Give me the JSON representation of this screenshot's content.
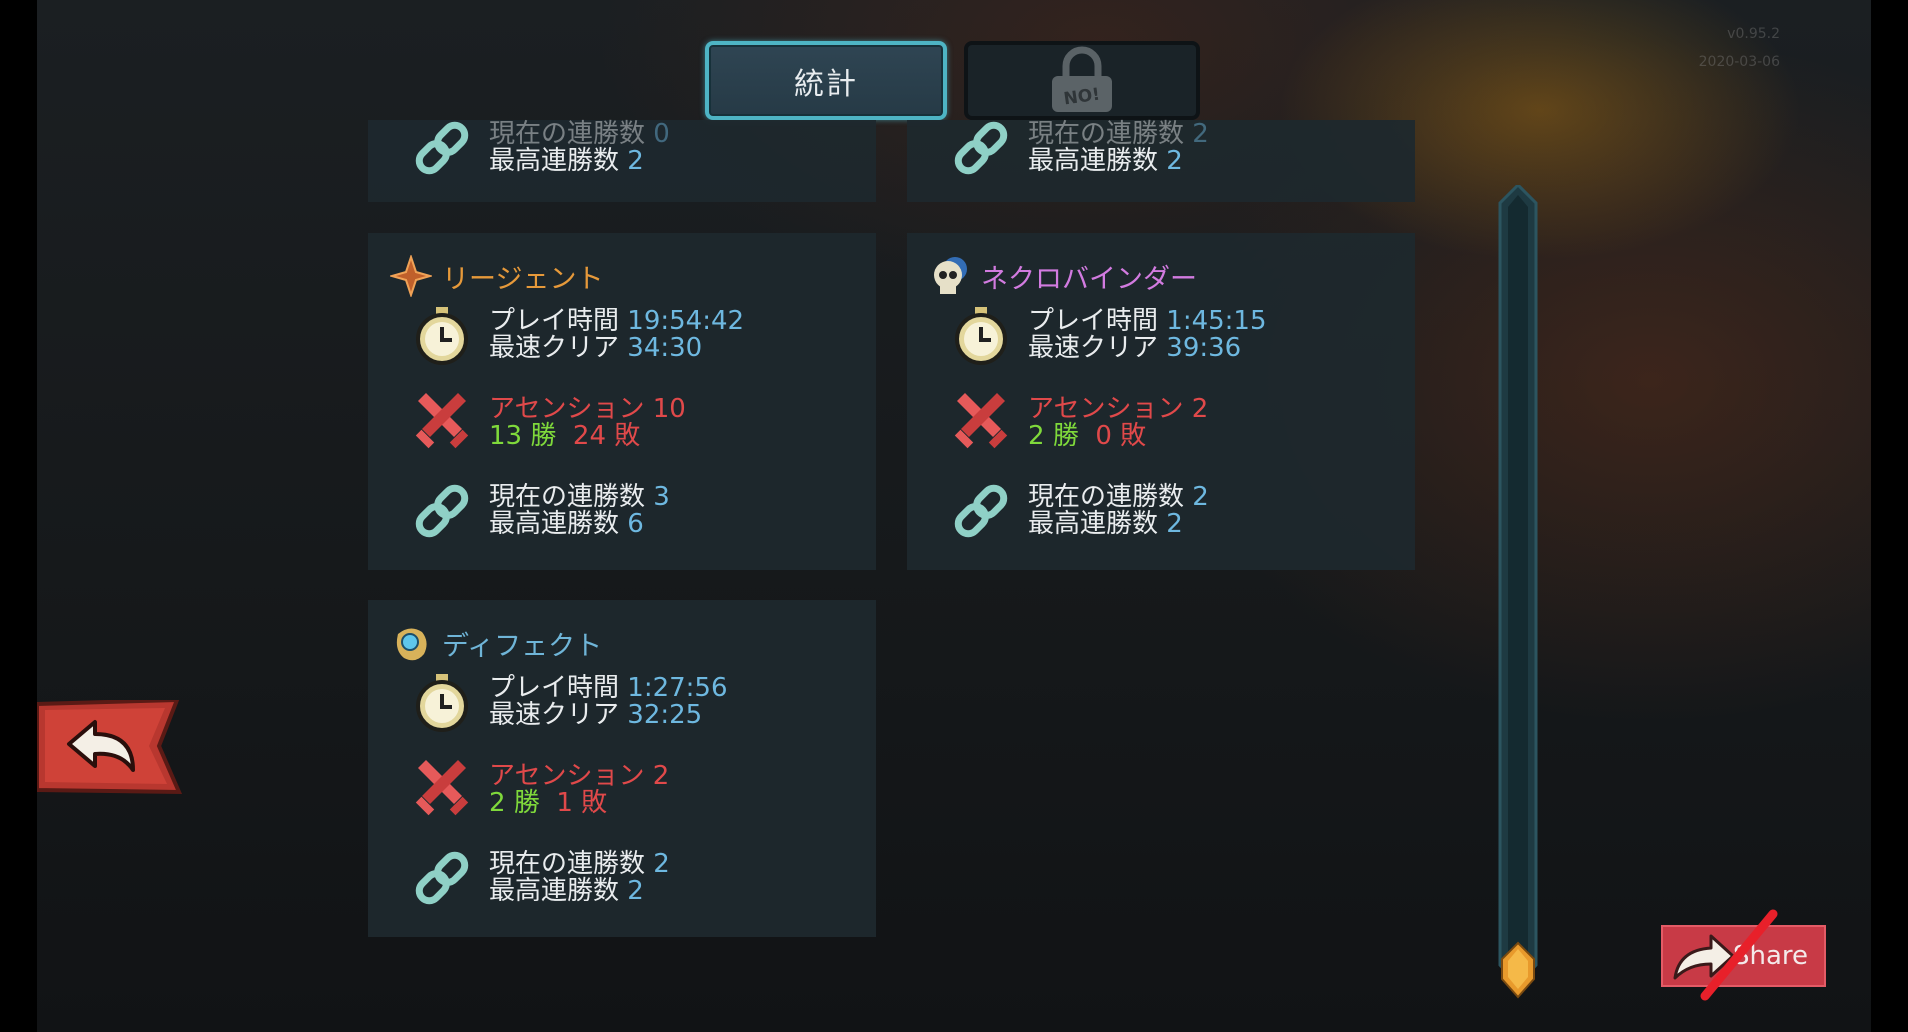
{
  "version": {
    "line1": "v0.95.2",
    "line2": "2020-03-06"
  },
  "tabs": {
    "stats_label": "統計",
    "locked_badge": "NO!"
  },
  "top_left_panel": {
    "current_label": "現在の連勝数",
    "current_value": "0",
    "best_label": "最高連勝数",
    "best_value": "2"
  },
  "top_right_panel": {
    "current_label": "現在の連勝数",
    "current_value": "2",
    "best_label": "最高連勝数",
    "best_value": "2"
  },
  "regent": {
    "name": "リージェント",
    "title_color": "#e6993a",
    "playtime_label": "プレイ時間",
    "playtime_value": "19:54:42",
    "fastest_label": "最速クリア",
    "fastest_value": "34:30",
    "ascension_label": "アセンション",
    "ascension_value": "10",
    "wins": "13",
    "wins_label": "勝",
    "losses": "24",
    "losses_label": "敗",
    "current_label": "現在の連勝数",
    "current_value": "3",
    "best_label": "最高連勝数",
    "best_value": "6"
  },
  "necrobinder": {
    "name": "ネクロバインダー",
    "title_color": "#d27be0",
    "playtime_label": "プレイ時間",
    "playtime_value": "1:45:15",
    "fastest_label": "最速クリア",
    "fastest_value": "39:36",
    "ascension_label": "アセンション",
    "ascension_value": "2",
    "wins": "2",
    "wins_label": "勝",
    "losses": "0",
    "losses_label": "敗",
    "current_label": "現在の連勝数",
    "current_value": "2",
    "best_label": "最高連勝数",
    "best_value": "2"
  },
  "defect": {
    "name": "ディフェクト",
    "title_color": "#6fb5d8",
    "playtime_label": "プレイ時間",
    "playtime_value": "1:27:56",
    "fastest_label": "最速クリア",
    "fastest_value": "32:25",
    "ascension_label": "アセンション",
    "ascension_value": "2",
    "wins": "2",
    "wins_label": "勝",
    "losses": "1",
    "losses_label": "敗",
    "current_label": "現在の連勝数",
    "current_value": "2",
    "best_label": "最高連勝数",
    "best_value": "2"
  },
  "share": {
    "label": "Share"
  },
  "colors": {
    "accent_cyan": "#4eb4c4",
    "value_blue": "#6eb8e0",
    "loss_red": "#e0494a",
    "win_green": "#7fd93b",
    "share_red": "#c83a46"
  },
  "icons": {
    "time": "stopwatch-icon",
    "ascension": "crossed-swords-icon",
    "streak": "chain-link-icon",
    "back": "back-arrow-icon",
    "scroll_thumb": "gem-icon"
  }
}
